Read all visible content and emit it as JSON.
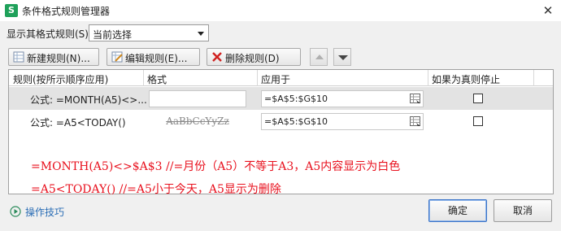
{
  "window": {
    "title": "条件格式规则管理器",
    "app_icon_letter": "S",
    "close_glyph": "✕"
  },
  "filter": {
    "label": "显示其格式规则(S):",
    "selected": "当前选择"
  },
  "toolbar": {
    "new_rule": "新建规则(N)...",
    "edit_rule": "编辑规则(E)...",
    "delete_rule": "删除规则(D)"
  },
  "table": {
    "headers": [
      "规则(按所示顺序应用)",
      "格式",
      "应用于",
      "如果为真则停止"
    ],
    "rows": [
      {
        "rule": "公式: =MONTH(A5)<>...",
        "format_preview": "",
        "applies_to": "=$A$5:$G$10",
        "stop_if_true": false,
        "selected": true
      },
      {
        "rule": "公式: =A5<TODAY()",
        "format_preview": "AaBbCcYyZz",
        "applies_to": "=$A$5:$G$10",
        "stop_if_true": false,
        "selected": false
      }
    ]
  },
  "annotations": [
    "=MONTH(A5)<>$A$3  //=月份（A5）不等于A3，A5内容显示为白色",
    "=A5<TODAY()    //=A5小于今天，A5显示为删除"
  ],
  "footer": {
    "tips": "操作技巧",
    "ok": "确定",
    "cancel": "取消"
  },
  "colors": {
    "annotation": "#e8101d",
    "link": "#2a6db5",
    "app_icon": "#1fa15a"
  }
}
